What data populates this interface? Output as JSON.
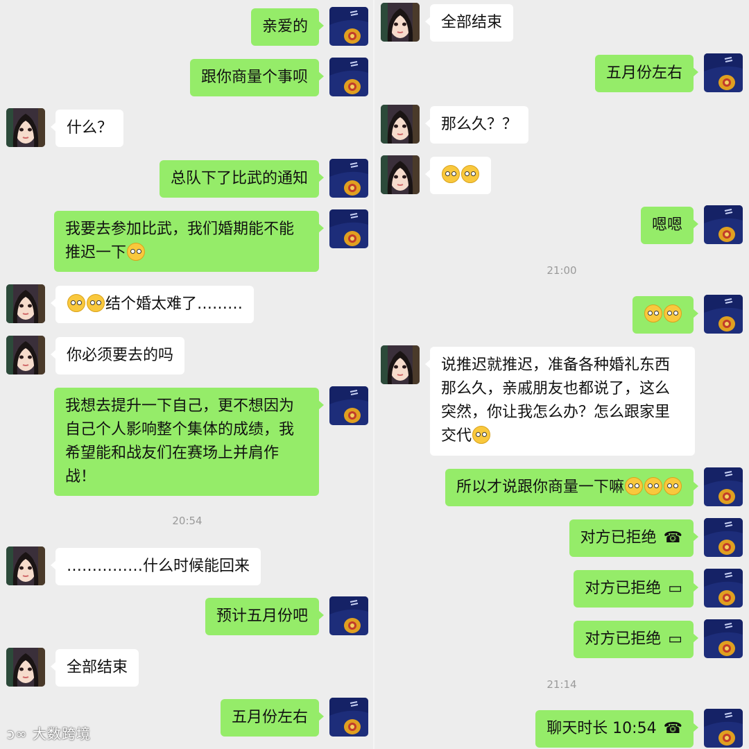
{
  "left_panel": {
    "messages": [
      {
        "from": "me",
        "text": "亲爱的"
      },
      {
        "from": "me",
        "text": "跟你商量个事呗"
      },
      {
        "from": "them",
        "text": "什么？"
      },
      {
        "from": "me",
        "text": "总队下了比武的通知"
      },
      {
        "from": "me",
        "text": "我要去参加比武，我们婚期能不能推迟一下"
      },
      {
        "from": "them",
        "text": "结个婚太难了………"
      },
      {
        "from": "them",
        "text": "你必须要去的吗"
      },
      {
        "from": "me",
        "text": "我想去提升一下自己，更不想因为自己个人影响整个集体的成绩，我希望能和战友们在赛场上并肩作战！"
      },
      {
        "from": "system",
        "text": "20:54"
      },
      {
        "from": "them",
        "text": "……………什么时候能回来"
      },
      {
        "from": "me",
        "text": "预计五月份吧"
      },
      {
        "from": "them",
        "text": "全部结束"
      },
      {
        "from": "me",
        "text": "五月份左右"
      }
    ]
  },
  "right_panel": {
    "messages": [
      {
        "from": "them",
        "text": "全部结束"
      },
      {
        "from": "me",
        "text": "五月份左右"
      },
      {
        "from": "them",
        "text": "那么久？？"
      },
      {
        "from": "them",
        "text": "",
        "emoji": "pleading-face x2"
      },
      {
        "from": "me",
        "text": "嗯嗯"
      },
      {
        "from": "system",
        "text": "21:00"
      },
      {
        "from": "me",
        "text": "",
        "emoji": "crying-face x2"
      },
      {
        "from": "them",
        "text": "说推迟就推迟，准备各种婚礼东西那么久，亲戚朋友也都说了，这么突然，你让我怎么办？怎么跟家里交代"
      },
      {
        "from": "me",
        "text": "所以才说跟你商量一下嘛"
      },
      {
        "from": "me",
        "text": "对方已拒绝",
        "icon": "phone-hangup-icon"
      },
      {
        "from": "me",
        "text": "对方已拒绝",
        "icon": "video-call-icon"
      },
      {
        "from": "me",
        "text": "对方已拒绝",
        "icon": "video-call-icon"
      },
      {
        "from": "system",
        "text": "21:14"
      },
      {
        "from": "me",
        "text": "聊天时长 10:54",
        "icon": "phone-hangup-icon"
      }
    ]
  },
  "watermark": "大数跨境",
  "colors": {
    "me_bubble": "#95ec69",
    "them_bubble": "#ffffff",
    "background": "#ededed"
  }
}
